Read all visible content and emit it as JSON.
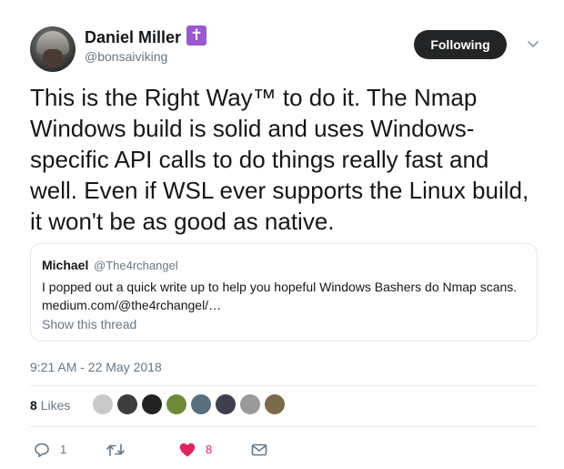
{
  "author": {
    "name": "Daniel Miller",
    "badge": "✝",
    "handle": "@bonsaiviking"
  },
  "follow_label": "Following",
  "text": "This is the Right Way™ to do it. The Nmap Windows build is solid and uses Windows-specific API calls to do things really fast and well. Even if WSL ever supports the Linux build, it won't be as good as native.",
  "quote": {
    "name": "Michael",
    "handle": "@The4rchangel",
    "text": "I popped out a quick write up to help you hopeful Windows Bashers do Nmap scans. medium.com/@the4rchangel/…",
    "thread_link": "Show this thread"
  },
  "timestamp": "9:21 AM - 22 May 2018",
  "likes": {
    "count": "8",
    "label": "Likes"
  },
  "liker_avatar_colors": [
    "#c9c9c9",
    "#3d3d3d",
    "#222222",
    "#6f8b3a",
    "#5a6f7d",
    "#3f3f4f",
    "#9a9a9a",
    "#7a6a4a"
  ],
  "actions": {
    "reply_count": "1",
    "retweet_count": "",
    "like_count": "8"
  },
  "colors": {
    "accent_like": "#e0245e",
    "muted": "#657786",
    "badge": "#9b59d0"
  }
}
